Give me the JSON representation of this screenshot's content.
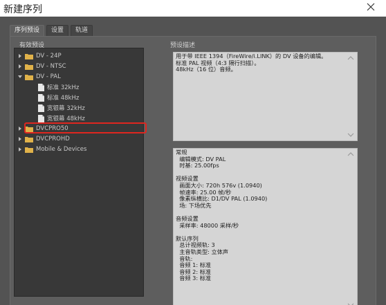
{
  "window": {
    "title": "新建序列"
  },
  "tabs": [
    {
      "label": "序列预设"
    },
    {
      "label": "设置"
    },
    {
      "label": "轨道"
    }
  ],
  "presets": {
    "section_label": "有效预设",
    "items": [
      {
        "label": "DV - 24P",
        "type": "folder",
        "expanded": false
      },
      {
        "label": "DV - NTSC",
        "type": "folder",
        "expanded": false
      },
      {
        "label": "DV - PAL",
        "type": "folder",
        "expanded": true
      },
      {
        "label": "标准 32kHz",
        "type": "file"
      },
      {
        "label": "标准 48kHz",
        "type": "file",
        "selected": true
      },
      {
        "label": "宽银幕 32kHz",
        "type": "file"
      },
      {
        "label": "宽银幕 48kHz",
        "type": "file"
      },
      {
        "label": "DVCPRO50",
        "type": "folder",
        "expanded": false
      },
      {
        "label": "DVCPROHD",
        "type": "folder",
        "expanded": false
      },
      {
        "label": "Mobile & Devices",
        "type": "folder",
        "expanded": false
      }
    ]
  },
  "description": {
    "section_label": "预设描述",
    "summary_lines": [
      "用于带 IEEE 1394（FireWire/i.LINK）的 DV 设备的编辑。",
      "标准 PAL 视频（4:3 隔行扫描）。",
      "48kHz（16 位）音频。"
    ],
    "detail_lines": [
      "常规",
      "  编辑模式: DV PAL",
      "  时基: 25.00fps",
      "",
      "视频设置",
      "  画面大小: 720h 576v (1.0940)",
      "  帧速率: 25.00 帧/秒",
      "  像素纵横比: D1/DV PAL (1.0940)",
      "  场: 下场优先",
      "",
      "音频设置",
      "  采样率: 48000 采样/秒",
      "",
      "默认序列",
      "  总计视频轨: 3",
      "  主音轨类型: 立体声",
      "  音轨:",
      "  音频 1: 标准",
      "  音频 2: 标准",
      "  音频 3: 标准"
    ]
  },
  "colors": {
    "highlight": "#e0261f",
    "folder": "#e0b24a"
  }
}
